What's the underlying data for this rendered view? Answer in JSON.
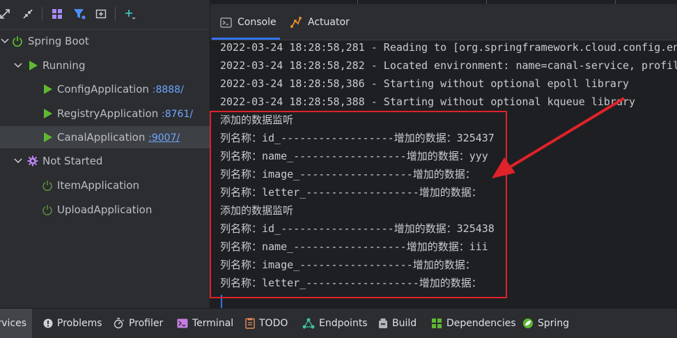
{
  "toolbar": {
    "icons": [
      "expand-icon",
      "collapse-icon",
      "group-icon",
      "filter-icon",
      "add-service-icon",
      "add-icon"
    ]
  },
  "tree": {
    "spring_boot": "Spring Boot",
    "running": "Running",
    "config_app": "ConfigApplication",
    "config_port": ":8888/",
    "registry_app": "RegistryApplication",
    "registry_port": ":8761/",
    "canal_app": "CanalApplication",
    "canal_port": ":9007/",
    "not_started": "Not Started",
    "item_app": "ItemApplication",
    "upload_app": "UploadApplication"
  },
  "tabs": {
    "console": "Console",
    "actuator": "Actuator"
  },
  "console": {
    "lines": [
      "2022-03-24 18:28:58,281 - Reading to [org.springframework.cloud.config.en",
      "2022-03-24 18:28:58,282 - Located environment: name=canal-service, profil",
      "2022-03-24 18:28:58,386 - Starting without optional epoll library",
      "2022-03-24 18:28:58,388 - Starting without optional kqueue library",
      "添加的数据监听",
      "列名称：id_------------------增加的数据：325437",
      "列名称：name_------------------增加的数据：yyy",
      "列名称：image_------------------增加的数据：",
      "列名称：letter_------------------增加的数据：",
      "添加的数据监听",
      "列名称：id_------------------增加的数据：325438",
      "列名称：name_------------------增加的数据：iii",
      "列名称：image_------------------增加的数据：",
      "列名称：letter_------------------增加的数据："
    ]
  },
  "bottom": {
    "services": "Services",
    "problems": "Problems",
    "profiler": "Profiler",
    "terminal": "Terminal",
    "todo": "TODO",
    "endpoints": "Endpoints",
    "build": "Build",
    "dependencies": "Dependencies",
    "spring": "Spring"
  },
  "colors": {
    "accent": "#3574f0",
    "run_green": "#5fb832",
    "annotation_red": "#e0222a",
    "link_blue": "#6ea8ff"
  }
}
